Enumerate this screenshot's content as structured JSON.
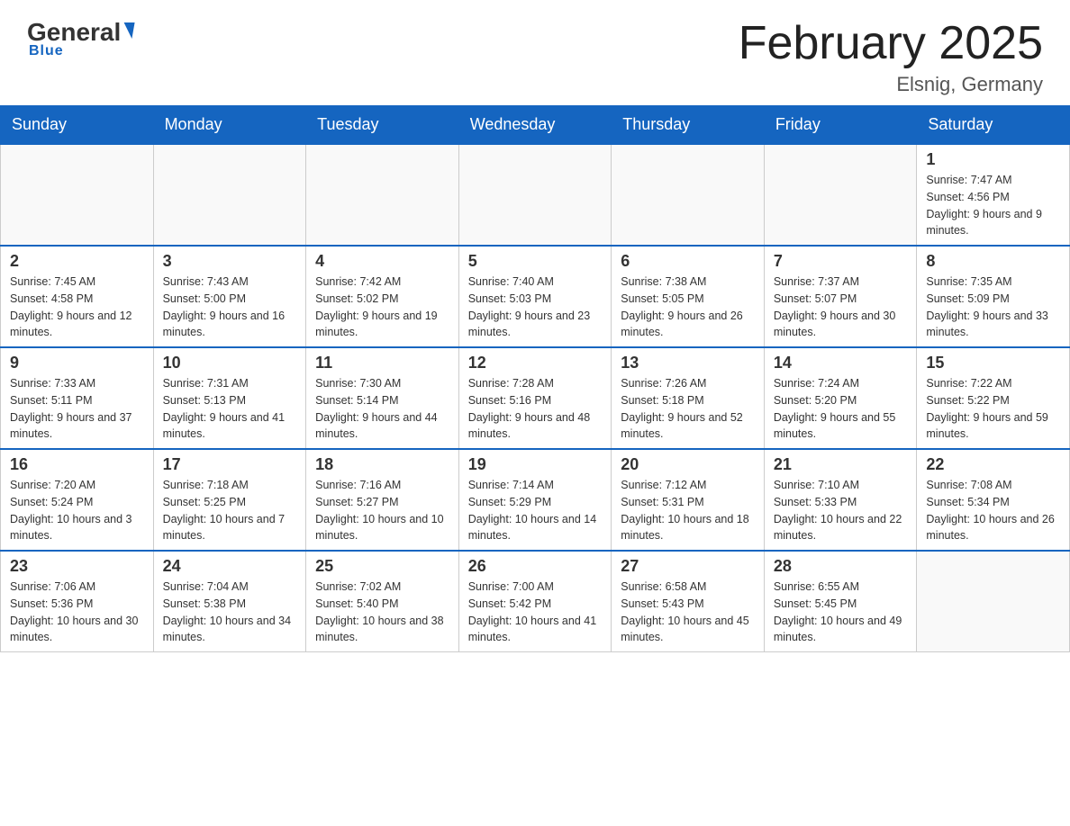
{
  "header": {
    "logo": {
      "general": "General",
      "blue": "Blue",
      "underline": "Blue"
    },
    "title": "February 2025",
    "location": "Elsnig, Germany"
  },
  "calendar": {
    "days_of_week": [
      "Sunday",
      "Monday",
      "Tuesday",
      "Wednesday",
      "Thursday",
      "Friday",
      "Saturday"
    ],
    "weeks": [
      {
        "days": [
          {
            "number": "",
            "info": ""
          },
          {
            "number": "",
            "info": ""
          },
          {
            "number": "",
            "info": ""
          },
          {
            "number": "",
            "info": ""
          },
          {
            "number": "",
            "info": ""
          },
          {
            "number": "",
            "info": ""
          },
          {
            "number": "1",
            "info": "Sunrise: 7:47 AM\nSunset: 4:56 PM\nDaylight: 9 hours and 9 minutes."
          }
        ]
      },
      {
        "days": [
          {
            "number": "2",
            "info": "Sunrise: 7:45 AM\nSunset: 4:58 PM\nDaylight: 9 hours and 12 minutes."
          },
          {
            "number": "3",
            "info": "Sunrise: 7:43 AM\nSunset: 5:00 PM\nDaylight: 9 hours and 16 minutes."
          },
          {
            "number": "4",
            "info": "Sunrise: 7:42 AM\nSunset: 5:02 PM\nDaylight: 9 hours and 19 minutes."
          },
          {
            "number": "5",
            "info": "Sunrise: 7:40 AM\nSunset: 5:03 PM\nDaylight: 9 hours and 23 minutes."
          },
          {
            "number": "6",
            "info": "Sunrise: 7:38 AM\nSunset: 5:05 PM\nDaylight: 9 hours and 26 minutes."
          },
          {
            "number": "7",
            "info": "Sunrise: 7:37 AM\nSunset: 5:07 PM\nDaylight: 9 hours and 30 minutes."
          },
          {
            "number": "8",
            "info": "Sunrise: 7:35 AM\nSunset: 5:09 PM\nDaylight: 9 hours and 33 minutes."
          }
        ]
      },
      {
        "days": [
          {
            "number": "9",
            "info": "Sunrise: 7:33 AM\nSunset: 5:11 PM\nDaylight: 9 hours and 37 minutes."
          },
          {
            "number": "10",
            "info": "Sunrise: 7:31 AM\nSunset: 5:13 PM\nDaylight: 9 hours and 41 minutes."
          },
          {
            "number": "11",
            "info": "Sunrise: 7:30 AM\nSunset: 5:14 PM\nDaylight: 9 hours and 44 minutes."
          },
          {
            "number": "12",
            "info": "Sunrise: 7:28 AM\nSunset: 5:16 PM\nDaylight: 9 hours and 48 minutes."
          },
          {
            "number": "13",
            "info": "Sunrise: 7:26 AM\nSunset: 5:18 PM\nDaylight: 9 hours and 52 minutes."
          },
          {
            "number": "14",
            "info": "Sunrise: 7:24 AM\nSunset: 5:20 PM\nDaylight: 9 hours and 55 minutes."
          },
          {
            "number": "15",
            "info": "Sunrise: 7:22 AM\nSunset: 5:22 PM\nDaylight: 9 hours and 59 minutes."
          }
        ]
      },
      {
        "days": [
          {
            "number": "16",
            "info": "Sunrise: 7:20 AM\nSunset: 5:24 PM\nDaylight: 10 hours and 3 minutes."
          },
          {
            "number": "17",
            "info": "Sunrise: 7:18 AM\nSunset: 5:25 PM\nDaylight: 10 hours and 7 minutes."
          },
          {
            "number": "18",
            "info": "Sunrise: 7:16 AM\nSunset: 5:27 PM\nDaylight: 10 hours and 10 minutes."
          },
          {
            "number": "19",
            "info": "Sunrise: 7:14 AM\nSunset: 5:29 PM\nDaylight: 10 hours and 14 minutes."
          },
          {
            "number": "20",
            "info": "Sunrise: 7:12 AM\nSunset: 5:31 PM\nDaylight: 10 hours and 18 minutes."
          },
          {
            "number": "21",
            "info": "Sunrise: 7:10 AM\nSunset: 5:33 PM\nDaylight: 10 hours and 22 minutes."
          },
          {
            "number": "22",
            "info": "Sunrise: 7:08 AM\nSunset: 5:34 PM\nDaylight: 10 hours and 26 minutes."
          }
        ]
      },
      {
        "days": [
          {
            "number": "23",
            "info": "Sunrise: 7:06 AM\nSunset: 5:36 PM\nDaylight: 10 hours and 30 minutes."
          },
          {
            "number": "24",
            "info": "Sunrise: 7:04 AM\nSunset: 5:38 PM\nDaylight: 10 hours and 34 minutes."
          },
          {
            "number": "25",
            "info": "Sunrise: 7:02 AM\nSunset: 5:40 PM\nDaylight: 10 hours and 38 minutes."
          },
          {
            "number": "26",
            "info": "Sunrise: 7:00 AM\nSunset: 5:42 PM\nDaylight: 10 hours and 41 minutes."
          },
          {
            "number": "27",
            "info": "Sunrise: 6:58 AM\nSunset: 5:43 PM\nDaylight: 10 hours and 45 minutes."
          },
          {
            "number": "28",
            "info": "Sunrise: 6:55 AM\nSunset: 5:45 PM\nDaylight: 10 hours and 49 minutes."
          },
          {
            "number": "",
            "info": ""
          }
        ]
      }
    ]
  }
}
